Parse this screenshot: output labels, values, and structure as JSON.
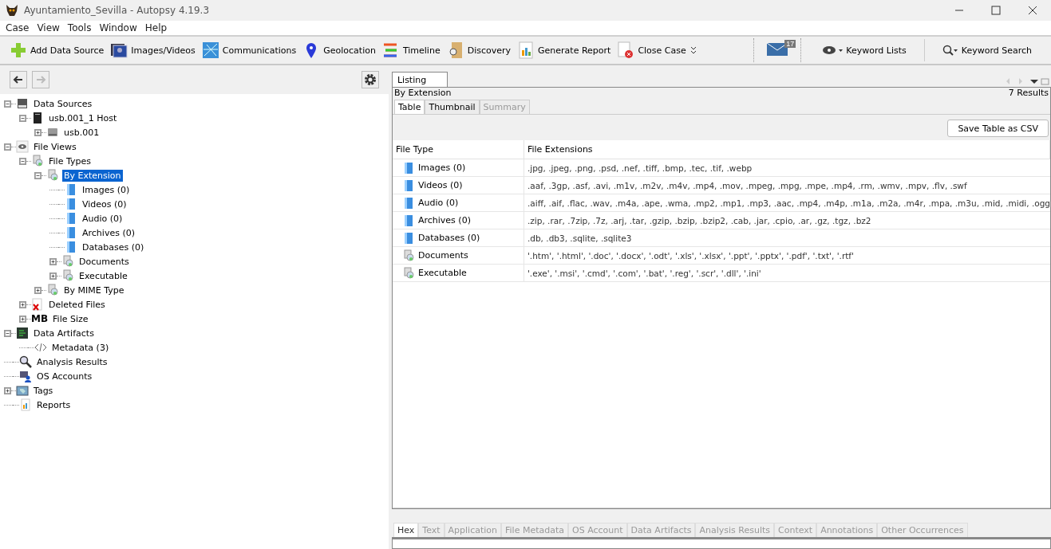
{
  "window": {
    "title": "Ayuntamiento_Sevilla - Autopsy 4.19.3"
  },
  "menu": [
    "Case",
    "View",
    "Tools",
    "Window",
    "Help"
  ],
  "toolbar": [
    {
      "kind": "add",
      "label": "Add Data Source"
    },
    {
      "kind": "images",
      "label": "Images/Videos"
    },
    {
      "kind": "comms",
      "label": "Communications"
    },
    {
      "kind": "geo",
      "label": "Geolocation"
    },
    {
      "kind": "timeline",
      "label": "Timeline"
    },
    {
      "kind": "discovery",
      "label": "Discovery"
    },
    {
      "kind": "report",
      "label": "Generate Report"
    },
    {
      "kind": "close",
      "label": "Close Case"
    }
  ],
  "notifications": {
    "count": "17"
  },
  "keyword_lists": {
    "label": "Keyword Lists"
  },
  "keyword_search": {
    "label": "Keyword Search"
  },
  "tree": [
    {
      "label": "Data Sources",
      "kind": "disk",
      "expanded": true,
      "selected": false,
      "children": [
        {
          "label": "usb.001_1 Host",
          "kind": "host",
          "expanded": true,
          "selected": false,
          "children": [
            {
              "label": "usb.001",
              "kind": "drive",
              "expanded": false,
              "selected": false
            }
          ]
        }
      ]
    },
    {
      "label": "File Views",
      "kind": "eye",
      "expanded": true,
      "selected": false,
      "children": [
        {
          "label": "File Types",
          "kind": "filetypes",
          "expanded": true,
          "selected": false,
          "children": [
            {
              "label": "By Extension",
              "kind": "filetypes",
              "expanded": true,
              "selected": true,
              "children": [
                {
                  "label": "Images (0)",
                  "kind": "folder",
                  "selected": false
                },
                {
                  "label": "Videos (0)",
                  "kind": "folder",
                  "selected": false
                },
                {
                  "label": "Audio (0)",
                  "kind": "folder",
                  "selected": false
                },
                {
                  "label": "Archives (0)",
                  "kind": "folder",
                  "selected": false
                },
                {
                  "label": "Databases (0)",
                  "kind": "folder",
                  "selected": false
                },
                {
                  "label": "Documents",
                  "kind": "filetypes",
                  "expanded": false,
                  "selected": false
                },
                {
                  "label": "Executable",
                  "kind": "filetypes",
                  "expanded": false,
                  "selected": false
                }
              ]
            },
            {
              "label": "By MIME Type",
              "kind": "filetypes",
              "expanded": false,
              "selected": false
            }
          ]
        },
        {
          "label": "Deleted Files",
          "kind": "deleted",
          "expanded": false,
          "selected": false
        },
        {
          "label": "File Size",
          "kind": "size",
          "icon_text": "MB",
          "expanded": false,
          "selected": false
        }
      ]
    },
    {
      "label": "Data Artifacts",
      "kind": "artifacts",
      "expanded": true,
      "selected": false,
      "children": [
        {
          "label": "Metadata (3)",
          "kind": "code",
          "selected": false
        }
      ]
    },
    {
      "label": "Analysis Results",
      "kind": "search",
      "selected": false
    },
    {
      "label": "OS Accounts",
      "kind": "accounts",
      "selected": false
    },
    {
      "label": "Tags",
      "kind": "tags",
      "expanded": false,
      "selected": false
    },
    {
      "label": "Reports",
      "kind": "reports",
      "selected": false
    }
  ],
  "listing": {
    "tab": "Listing",
    "breadcrumb": "By Extension",
    "results": "7  Results",
    "view_tabs": [
      {
        "label": "Table",
        "selected": true,
        "disabled": false
      },
      {
        "label": "Thumbnail",
        "selected": false,
        "disabled": false
      },
      {
        "label": "Summary",
        "selected": false,
        "disabled": true
      }
    ],
    "save_button": "Save Table as CSV",
    "columns": [
      "File Type",
      "File Extensions"
    ],
    "rows": [
      {
        "kind": "folder",
        "type": "Images (0)",
        "extensions": ".jpg, .jpeg, .png, .psd, .nef, .tiff, .bmp, .tec, .tif, .webp"
      },
      {
        "kind": "folder",
        "type": "Videos (0)",
        "extensions": ".aaf, .3gp, .asf, .avi, .m1v, .m2v, .m4v, .mp4, .mov, .mpeg, .mpg, .mpe, .mp4, .rm, .wmv, .mpv, .flv, .swf"
      },
      {
        "kind": "folder",
        "type": "Audio (0)",
        "extensions": ".aiff, .aif, .flac, .wav, .m4a, .ape, .wma, .mp2, .mp1, .mp3, .aac, .mp4, .m4p, .m1a, .m2a, .m4r, .mpa, .m3u, .mid, .midi, .ogg"
      },
      {
        "kind": "folder",
        "type": "Archives (0)",
        "extensions": ".zip, .rar, .7zip, .7z, .arj, .tar, .gzip, .bzip, .bzip2, .cab, .jar, .cpio, .ar, .gz, .tgz, .bz2"
      },
      {
        "kind": "folder",
        "type": "Databases (0)",
        "extensions": ".db, .db3, .sqlite, .sqlite3"
      },
      {
        "kind": "filetypes",
        "type": "Documents",
        "extensions": "'.htm', '.html', '.doc', '.docx', '.odt', '.xls', '.xlsx', '.ppt', '.pptx', '.pdf', '.txt', '.rtf'"
      },
      {
        "kind": "filetypes",
        "type": "Executable",
        "extensions": "'.exe', '.msi', '.cmd', '.com', '.bat', '.reg', '.scr', '.dll', '.ini'"
      }
    ]
  },
  "content_tabs": [
    {
      "label": "Hex",
      "selected": true,
      "disabled": false
    },
    {
      "label": "Text",
      "selected": false,
      "disabled": true
    },
    {
      "label": "Application",
      "selected": false,
      "disabled": true
    },
    {
      "label": "File Metadata",
      "selected": false,
      "disabled": true
    },
    {
      "label": "OS Account",
      "selected": false,
      "disabled": true
    },
    {
      "label": "Data Artifacts",
      "selected": false,
      "disabled": true
    },
    {
      "label": "Analysis Results",
      "selected": false,
      "disabled": true
    },
    {
      "label": "Context",
      "selected": false,
      "disabled": true
    },
    {
      "label": "Annotations",
      "selected": false,
      "disabled": true
    },
    {
      "label": "Other Occurrences",
      "selected": false,
      "disabled": true
    }
  ]
}
